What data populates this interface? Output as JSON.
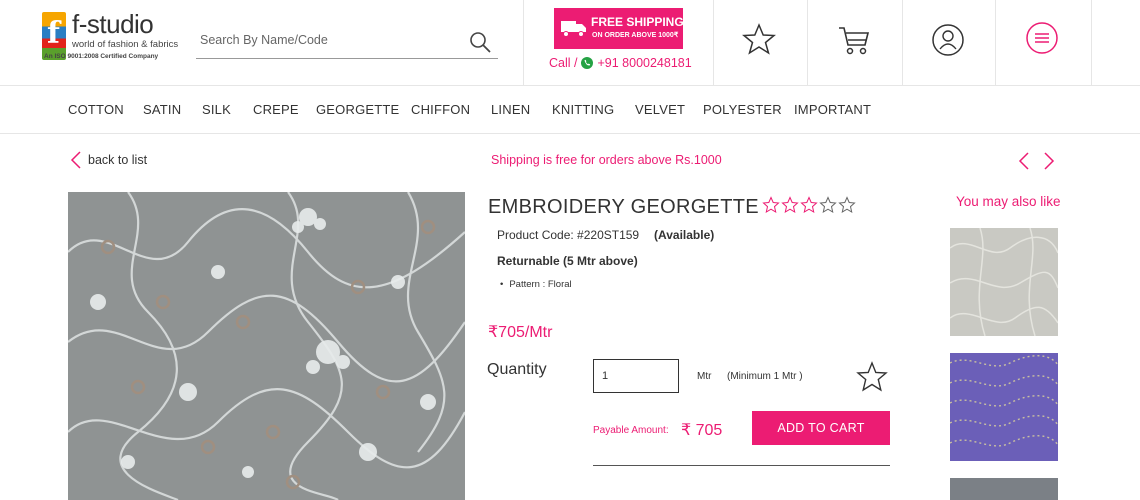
{
  "header": {
    "brand_name": "f-studio",
    "brand_tagline": "world of fashion & fabrics",
    "brand_iso": "An ISO 9001:2008 Certified Company",
    "search_placeholder": "Search By Name/Code",
    "shipping_banner_title": "FREE SHIPPING",
    "shipping_banner_sub": "ON ORDER ABOVE 1000₹",
    "call_label": "Call /",
    "call_number": "+91 8000248181",
    "icons": [
      "star-icon",
      "cart-icon",
      "user-icon",
      "menu-icon"
    ]
  },
  "nav": {
    "items": [
      "COTTON",
      "SATIN",
      "SILK",
      "CREPE",
      "GEORGETTE",
      "CHIFFON",
      "LINEN",
      "KNITTING",
      "VELVET",
      "POLYESTER",
      "IMPORTANT"
    ]
  },
  "subbar": {
    "back_label": "back to list",
    "shipping_note": "Shipping is free for orders above Rs.1000"
  },
  "product": {
    "title": "EMBROIDERY GEORGETTE",
    "rating": 0,
    "rating_max": 5,
    "code_label": "Product Code: #220ST159",
    "availability": "(Available)",
    "returnable": "Returnable (5 Mtr above)",
    "pattern": "Pattern : Floral",
    "price": "₹705/Mtr",
    "quantity_label": "Quantity",
    "quantity_value": "1",
    "unit": "Mtr",
    "minimum": "(Minimum 1 Mtr )",
    "payable_label": "Payable Amount:",
    "payable_amount": "₹ 705",
    "add_to_cart": "ADD TO CART"
  },
  "related": {
    "title": "You may also like"
  },
  "colors": {
    "accent": "#ec1c73",
    "text": "#333333",
    "divider": "#e6e6e6"
  }
}
